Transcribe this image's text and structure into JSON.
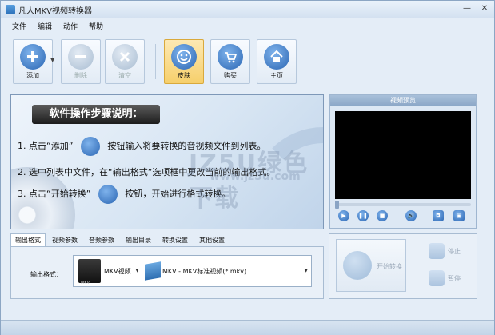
{
  "window": {
    "title": "凡人MKV视频转换器"
  },
  "menu": [
    "文件",
    "编辑",
    "动作",
    "帮助"
  ],
  "toolbar": {
    "add": "添加",
    "delete": "删除",
    "clear": "清空",
    "skin": "皮肤",
    "buy": "购买",
    "home": "主页"
  },
  "guide": {
    "heading": "软件操作步骤说明：",
    "step1_a": "1. 点击“添加”",
    "step1_b": "按钮输入将要转换的音视频文件到列表。",
    "step2": "2. 选中列表中文件，在“输出格式”选项框中更改当前的输出格式。",
    "step3_a": "3. 点击“开始转换”",
    "step3_b": "按钮，开始进行格式转换。"
  },
  "watermark": {
    "line1": "JZ5U绿色下载",
    "line2": "www.jz5u.com"
  },
  "preview": {
    "title": "视频预览"
  },
  "tabs": [
    "输出格式",
    "视频参数",
    "音频参数",
    "输出目录",
    "转换设置",
    "其他设置"
  ],
  "output": {
    "label": "输出格式：",
    "format": "MKV视频",
    "format_caption": "MKV",
    "preset": "MKV - MKV标准视频(*.mkv)"
  },
  "actions": {
    "start": "开始转换",
    "stop": "停止",
    "pause": "暂停"
  },
  "colors": {
    "accent": "#2b66b3",
    "skin_active": "#f6cf6b"
  }
}
